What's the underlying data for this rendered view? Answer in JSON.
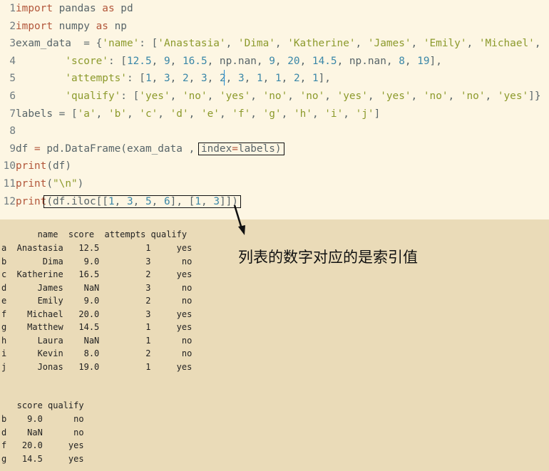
{
  "editor": {
    "lines": [
      {
        "n": "1",
        "tokens": [
          {
            "t": "import",
            "c": "kw"
          },
          {
            "t": " pandas ",
            "c": "txt"
          },
          {
            "t": "as",
            "c": "kw"
          },
          {
            "t": " pd",
            "c": "txt"
          }
        ]
      },
      {
        "n": "2",
        "tokens": [
          {
            "t": "import",
            "c": "kw"
          },
          {
            "t": " numpy ",
            "c": "txt"
          },
          {
            "t": "as",
            "c": "kw"
          },
          {
            "t": " np",
            "c": "txt"
          }
        ]
      },
      {
        "n": "3",
        "tokens": [
          {
            "t": "exam_data  = {",
            "c": "txt"
          },
          {
            "t": "'name'",
            "c": "str"
          },
          {
            "t": ": [",
            "c": "txt"
          },
          {
            "t": "'Anastasia'",
            "c": "str"
          },
          {
            "t": ", ",
            "c": "txt"
          },
          {
            "t": "'Dima'",
            "c": "str"
          },
          {
            "t": ", ",
            "c": "txt"
          },
          {
            "t": "'Katherine'",
            "c": "str"
          },
          {
            "t": ", ",
            "c": "txt"
          },
          {
            "t": "'James'",
            "c": "str"
          },
          {
            "t": ", ",
            "c": "txt"
          },
          {
            "t": "'Emily'",
            "c": "str"
          },
          {
            "t": ", ",
            "c": "txt"
          },
          {
            "t": "'Michael'",
            "c": "str"
          },
          {
            "t": ",",
            "c": "txt"
          }
        ]
      },
      {
        "n": "4",
        "tokens": [
          {
            "t": "        ",
            "c": "txt"
          },
          {
            "t": "'score'",
            "c": "str"
          },
          {
            "t": ": [",
            "c": "txt"
          },
          {
            "t": "12.5",
            "c": "num"
          },
          {
            "t": ", ",
            "c": "txt"
          },
          {
            "t": "9",
            "c": "num"
          },
          {
            "t": ", ",
            "c": "txt"
          },
          {
            "t": "16.5",
            "c": "num"
          },
          {
            "t": ", np.nan, ",
            "c": "txt"
          },
          {
            "t": "9",
            "c": "num"
          },
          {
            "t": ", ",
            "c": "txt"
          },
          {
            "t": "20",
            "c": "num"
          },
          {
            "t": ", ",
            "c": "txt"
          },
          {
            "t": "14.5",
            "c": "num"
          },
          {
            "t": ", np.nan, ",
            "c": "txt"
          },
          {
            "t": "8",
            "c": "num"
          },
          {
            "t": ", ",
            "c": "txt"
          },
          {
            "t": "19",
            "c": "num"
          },
          {
            "t": "],",
            "c": "txt"
          }
        ]
      },
      {
        "n": "5",
        "tokens": [
          {
            "t": "        ",
            "c": "txt"
          },
          {
            "t": "'attempts'",
            "c": "str"
          },
          {
            "t": ": [",
            "c": "txt"
          },
          {
            "t": "1",
            "c": "num"
          },
          {
            "t": ", ",
            "c": "txt"
          },
          {
            "t": "3",
            "c": "num"
          },
          {
            "t": ", ",
            "c": "txt"
          },
          {
            "t": "2",
            "c": "num"
          },
          {
            "t": ", ",
            "c": "txt"
          },
          {
            "t": "3",
            "c": "num"
          },
          {
            "t": ", ",
            "c": "txt"
          },
          {
            "t": "2",
            "c": "num"
          },
          {
            "t": ", ",
            "c": "txt"
          },
          {
            "t": "3",
            "c": "num"
          },
          {
            "t": ", ",
            "c": "txt"
          },
          {
            "t": "1",
            "c": "num"
          },
          {
            "t": ", ",
            "c": "txt"
          },
          {
            "t": "1",
            "c": "num"
          },
          {
            "t": ", ",
            "c": "txt"
          },
          {
            "t": "2",
            "c": "num"
          },
          {
            "t": ", ",
            "c": "txt"
          },
          {
            "t": "1",
            "c": "num"
          },
          {
            "t": "],",
            "c": "txt"
          }
        ]
      },
      {
        "n": "6",
        "tokens": [
          {
            "t": "        ",
            "c": "txt"
          },
          {
            "t": "'qualify'",
            "c": "str"
          },
          {
            "t": ": [",
            "c": "txt"
          },
          {
            "t": "'yes'",
            "c": "str"
          },
          {
            "t": ", ",
            "c": "txt"
          },
          {
            "t": "'no'",
            "c": "str"
          },
          {
            "t": ", ",
            "c": "txt"
          },
          {
            "t": "'yes'",
            "c": "str"
          },
          {
            "t": ", ",
            "c": "txt"
          },
          {
            "t": "'no'",
            "c": "str"
          },
          {
            "t": ", ",
            "c": "txt"
          },
          {
            "t": "'no'",
            "c": "str"
          },
          {
            "t": ", ",
            "c": "txt"
          },
          {
            "t": "'yes'",
            "c": "str"
          },
          {
            "t": ", ",
            "c": "txt"
          },
          {
            "t": "'yes'",
            "c": "str"
          },
          {
            "t": ", ",
            "c": "txt"
          },
          {
            "t": "'no'",
            "c": "str"
          },
          {
            "t": ", ",
            "c": "txt"
          },
          {
            "t": "'no'",
            "c": "str"
          },
          {
            "t": ", ",
            "c": "txt"
          },
          {
            "t": "'yes'",
            "c": "str"
          },
          {
            "t": "]}",
            "c": "txt"
          }
        ]
      },
      {
        "n": "7",
        "tokens": [
          {
            "t": "labels = [",
            "c": "txt"
          },
          {
            "t": "'a'",
            "c": "str"
          },
          {
            "t": ", ",
            "c": "txt"
          },
          {
            "t": "'b'",
            "c": "str"
          },
          {
            "t": ", ",
            "c": "txt"
          },
          {
            "t": "'c'",
            "c": "str"
          },
          {
            "t": ", ",
            "c": "txt"
          },
          {
            "t": "'d'",
            "c": "str"
          },
          {
            "t": ", ",
            "c": "txt"
          },
          {
            "t": "'e'",
            "c": "str"
          },
          {
            "t": ", ",
            "c": "txt"
          },
          {
            "t": "'f'",
            "c": "str"
          },
          {
            "t": ", ",
            "c": "txt"
          },
          {
            "t": "'g'",
            "c": "str"
          },
          {
            "t": ", ",
            "c": "txt"
          },
          {
            "t": "'h'",
            "c": "str"
          },
          {
            "t": ", ",
            "c": "txt"
          },
          {
            "t": "'i'",
            "c": "str"
          },
          {
            "t": ", ",
            "c": "txt"
          },
          {
            "t": "'j'",
            "c": "str"
          },
          {
            "t": "]",
            "c": "txt"
          }
        ]
      },
      {
        "n": "8",
        "tokens": []
      },
      {
        "n": "9",
        "tokens": [
          {
            "t": "df ",
            "c": "txt"
          },
          {
            "t": "=",
            "c": "kw"
          },
          {
            "t": " pd.DataFrame(exam_data , ",
            "c": "txt"
          },
          {
            "t": "index",
            "c": "txt",
            "box": "open"
          },
          {
            "t": "=",
            "c": "kw"
          },
          {
            "t": "labels)",
            "c": "txt",
            "box": "close"
          }
        ]
      },
      {
        "n": "10",
        "tokens": [
          {
            "t": "print",
            "c": "kw"
          },
          {
            "t": "(df)",
            "c": "txt"
          }
        ]
      },
      {
        "n": "11",
        "tokens": [
          {
            "t": "print",
            "c": "kw"
          },
          {
            "t": "(",
            "c": "txt"
          },
          {
            "t": "\"\\n\"",
            "c": "str"
          },
          {
            "t": ")",
            "c": "txt"
          }
        ]
      },
      {
        "n": "12",
        "tokens": [
          {
            "t": "print",
            "c": "kw"
          },
          {
            "t": "(",
            "c": "txt",
            "box": "open"
          },
          {
            "t": "df.iloc[[",
            "c": "txt"
          },
          {
            "t": "1",
            "c": "num"
          },
          {
            "t": ", ",
            "c": "txt"
          },
          {
            "t": "3",
            "c": "num"
          },
          {
            "t": ", ",
            "c": "txt"
          },
          {
            "t": "5",
            "c": "num"
          },
          {
            "t": ", ",
            "c": "txt"
          },
          {
            "t": "6",
            "c": "num"
          },
          {
            "t": "], [",
            "c": "txt"
          },
          {
            "t": "1",
            "c": "num"
          },
          {
            "t": ", ",
            "c": "txt"
          },
          {
            "t": "3",
            "c": "num"
          },
          {
            "t": "]])",
            "c": "txt",
            "box": "close"
          }
        ]
      }
    ]
  },
  "output": {
    "df_header": "       name  score  attempts qualify",
    "df_rows": [
      "a  Anastasia   12.5         1     yes",
      "b       Dima    9.0         3      no",
      "c  Katherine   16.5         2     yes",
      "d      James    NaN         3      no",
      "e      Emily    9.0         2      no",
      "f    Michael   20.0         3     yes",
      "g    Matthew   14.5         1     yes",
      "h      Laura    NaN         1      no",
      "i      Kevin    8.0         2      no",
      "j      Jonas   19.0         1     yes"
    ],
    "sub_header": "   score qualify",
    "sub_rows": [
      "b    9.0      no",
      "d    NaN      no",
      "f   20.0     yes",
      "g   14.5     yes"
    ]
  },
  "annotation": {
    "note": "列表的数字对应的是索引值"
  },
  "colors": {
    "editor_bg": "#fdf6e3",
    "output_bg": "#eadbb8",
    "keyword": "#b2563a",
    "string": "#8c9a2c",
    "number": "#3a87a8"
  }
}
